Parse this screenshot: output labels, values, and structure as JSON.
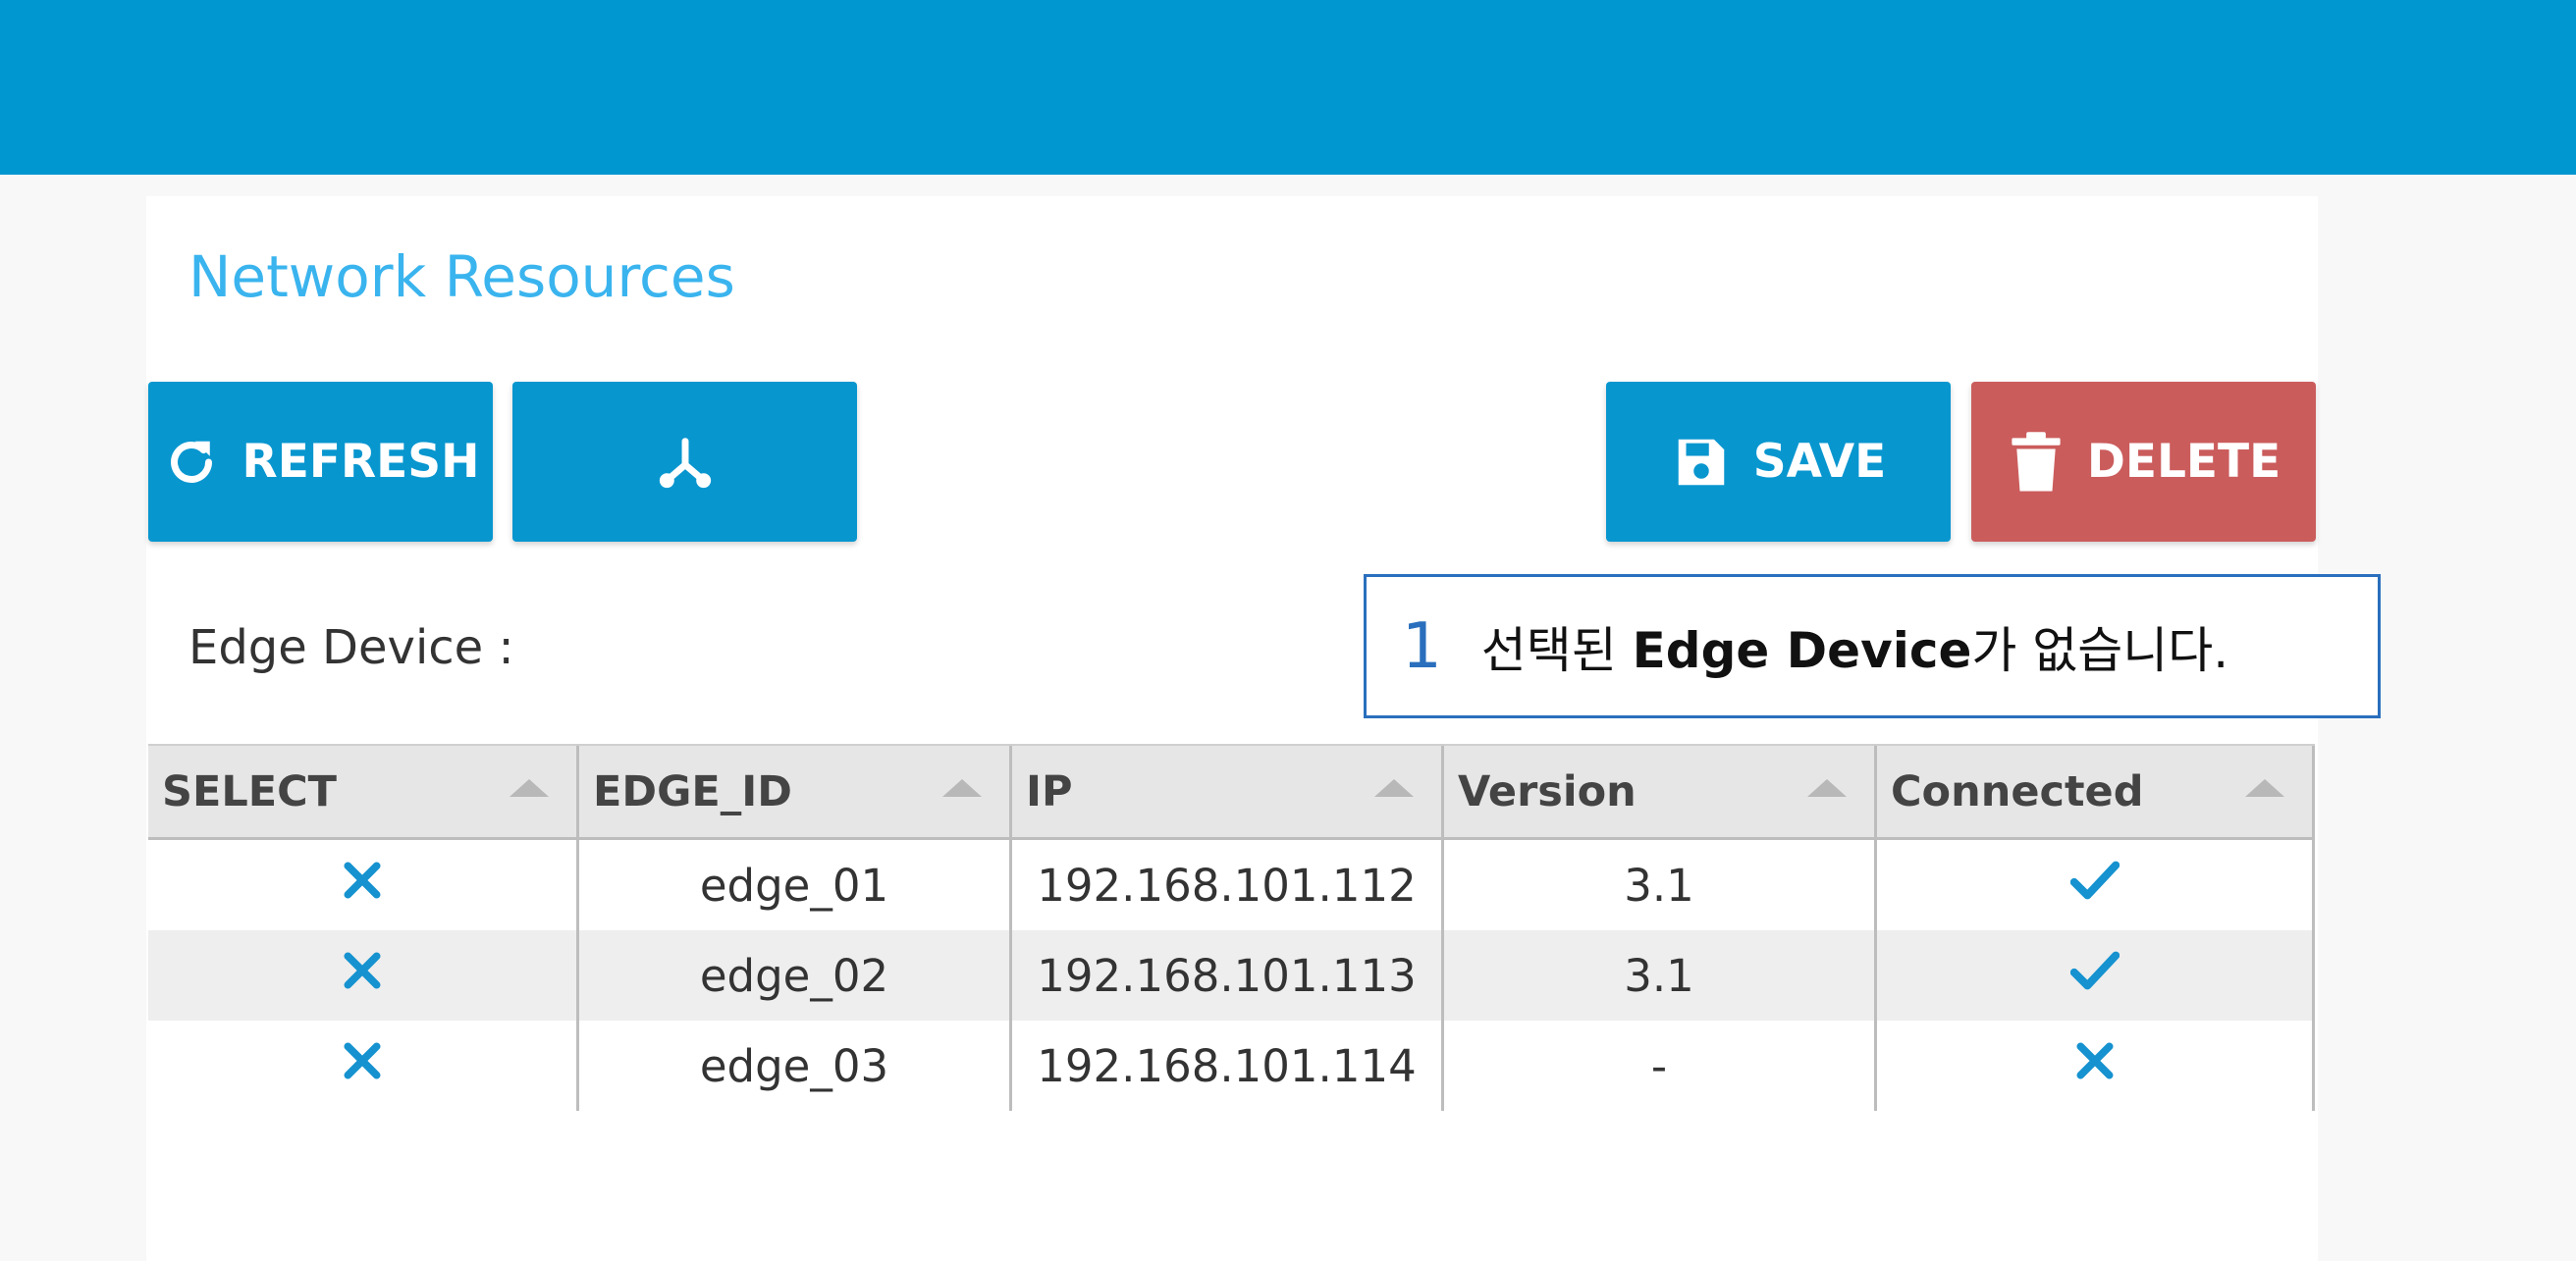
{
  "panel": {
    "title": "Network Resources"
  },
  "toolbar": {
    "refresh_label": "REFRESH",
    "save_label": "SAVE",
    "delete_label": "DELETE"
  },
  "edge_device": {
    "label": "Edge Device :"
  },
  "callout": {
    "number": "1",
    "message_prefix": "선택된 ",
    "message_bold": "Edge Device",
    "message_suffix": "가 없습니다."
  },
  "grid": {
    "columns": [
      "SELECT",
      "EDGE_ID",
      "IP",
      "Version",
      "Connected"
    ],
    "rows": [
      {
        "select": "unselected",
        "edge_id": "edge_01",
        "ip": "192.168.101.112",
        "version": "3.1",
        "connected": true
      },
      {
        "select": "unselected",
        "edge_id": "edge_02",
        "ip": "192.168.101.113",
        "version": "3.1",
        "connected": true
      },
      {
        "select": "unselected",
        "edge_id": "edge_03",
        "ip": "192.168.101.114",
        "version": "-",
        "connected": false
      }
    ]
  },
  "colors": {
    "header_bar": "#0096d0",
    "title": "#3ab4ee",
    "button_primary": "#0896cf",
    "button_danger": "#cb5c5c",
    "callout_border": "#2a6fbd",
    "icon_blue": "#1592cf"
  },
  "icons": {
    "refresh": "refresh-icon",
    "topology": "topology-icon",
    "save": "save-icon",
    "delete": "trash-icon",
    "unselected": "x-icon",
    "connected": "check-icon",
    "disconnected": "x-icon"
  }
}
